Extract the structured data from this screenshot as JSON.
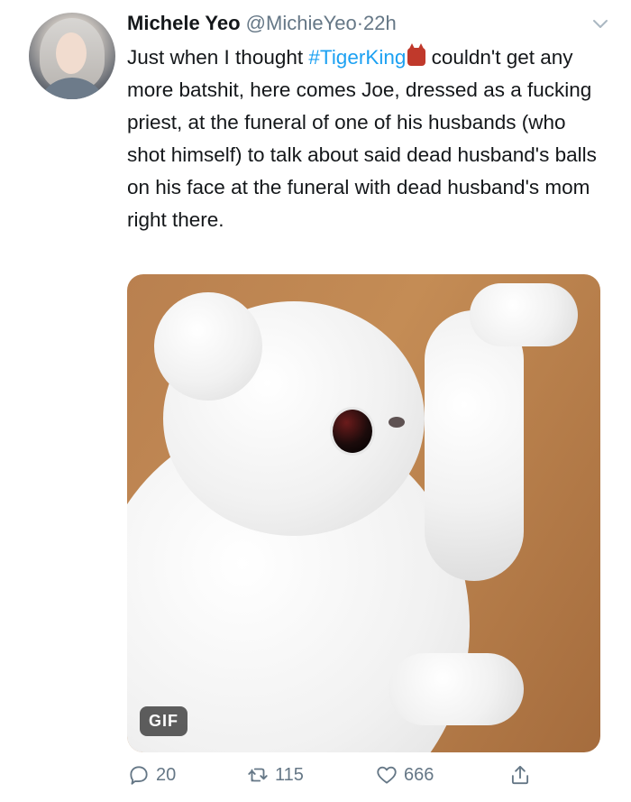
{
  "tweet": {
    "author_name": "Michele Yeo",
    "handle": "@MichieYeo",
    "separator": "·",
    "time": "22h",
    "text_before": "Just when I thought ",
    "hashtag": "#TigerKing",
    "text_after": " couldn't get any more batshit, here comes Joe, dressed as a fucking priest, at the funeral of one of his husbands (who shot himself) to talk about said dead husband's balls on his face at the funeral with dead husband's mom right there."
  },
  "media": {
    "badge": "GIF"
  },
  "actions": {
    "reply_count": "20",
    "retweet_count": "115",
    "like_count": "666"
  },
  "colors": {
    "link": "#1da1f2",
    "meta": "#657786",
    "text": "#14171a"
  },
  "icons": [
    "chevron-down-icon",
    "reply-icon",
    "retweet-icon",
    "like-icon",
    "share-icon",
    "devil-emoji-icon"
  ]
}
